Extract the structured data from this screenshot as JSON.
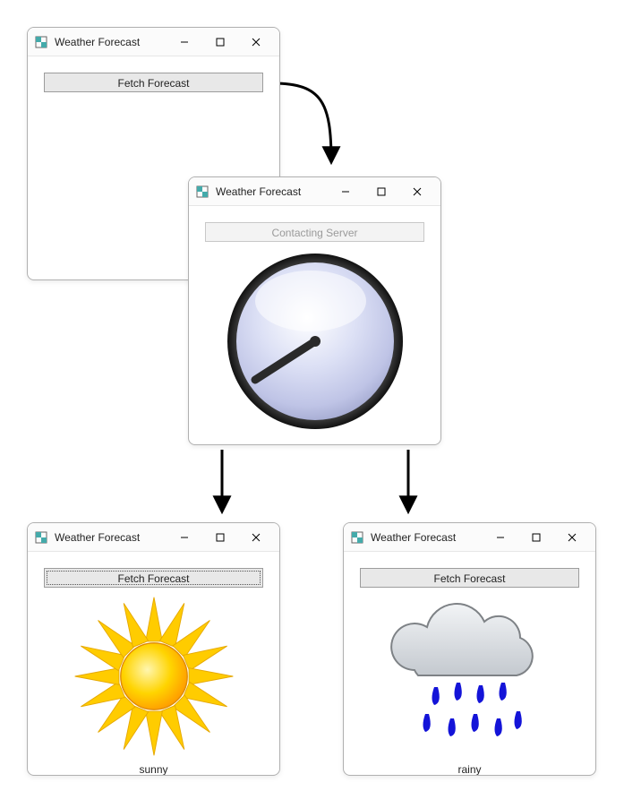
{
  "windows": {
    "initial": {
      "title": "Weather Forecast",
      "button_label": "Fetch Forecast"
    },
    "loading": {
      "title": "Weather Forecast",
      "button_label": "Contacting Server"
    },
    "sunny": {
      "title": "Weather Forecast",
      "button_label": "Fetch Forecast",
      "status": "sunny"
    },
    "rainy": {
      "title": "Weather Forecast",
      "button_label": "Fetch Forecast",
      "status": "rainy"
    }
  },
  "icons": {
    "app_icon": "app-icon",
    "minimize": "minimize-icon",
    "maximize": "maximize-icon",
    "close": "close-icon",
    "spinner": "spinner-icon",
    "sun": "sun-icon",
    "rain": "rain-cloud-icon"
  },
  "colors": {
    "sun_fill": "#ffd400",
    "sun_core": "#ffb000",
    "cloud_fill": "#d9dde1",
    "cloud_stroke": "#8c8f92",
    "rain": "#1414d8",
    "spinner_rim": "#2a2a2a",
    "spinner_glass": "#d6d9f2"
  }
}
